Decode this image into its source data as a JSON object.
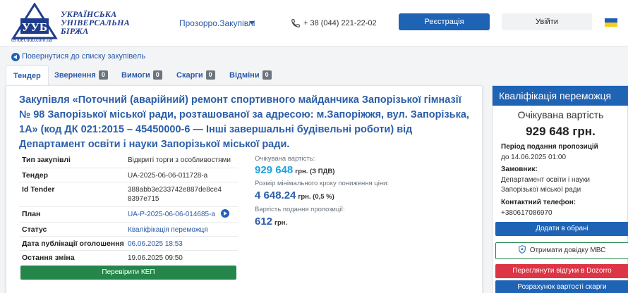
{
  "header": {
    "logo_lines": [
      "УКРАЇНСЬКА",
      "УНІВЕРСАЛЬНА",
      "БІРЖА"
    ],
    "logo_url": "tender.uub.com.ua",
    "nav_link": "Прозорро.Закупівлі",
    "phone": "+ 38 (044) 221-22-02",
    "register_label": "Реєстрація",
    "login_label": "Увійти"
  },
  "back_link": "Повернутися до списку закупівель",
  "tabs": [
    {
      "label": "Тендер",
      "active": true
    },
    {
      "label": "Звернення",
      "count": "0"
    },
    {
      "label": "Вимоги",
      "count": "0"
    },
    {
      "label": "Скарги",
      "count": "0"
    },
    {
      "label": "Відміни",
      "count": "0"
    }
  ],
  "tender": {
    "title": "Закупівля «Поточний (аварійний) ремонт спортивного майданчика Запорізької гімназії № 98 Запорізької міської ради, розташованої за адресою: м.Запоріжжя, вул. Запорізька, 1А» (код ДК 021:2015 – 45450000-6 — Інші завершальні будівельні роботи) від Департамент освіти і науки Запорізької міської ради.",
    "rows": [
      {
        "key": "Тип закупівлі",
        "value": "Відкриті торги з особливостями"
      },
      {
        "key": "Тендер",
        "value": "UA-2025-06-06-011728-a"
      },
      {
        "key": "Id Tender",
        "value": "388abb3e233742e887de8ce48397e715"
      },
      {
        "key": "План",
        "value": "UA-P-2025-06-06-014685-a"
      },
      {
        "key": "Статус",
        "value": "Кваліфікація переможця"
      },
      {
        "key": "Дата публікації оголошення",
        "value": "06.06.2025 18:53"
      },
      {
        "key": "Остання зміна",
        "value": "19.06.2025 09:50"
      }
    ],
    "check_kep_label": "Перевірити КЕП",
    "expected_label": "Очікувана вартість:",
    "expected_value": "929 648",
    "expected_unit": "грн. (З ПДВ)",
    "step_label": "Розмір мінімального кроку пониження ціни:",
    "step_value": "4 648.24",
    "step_unit": "грн. (0,5 %)",
    "cost_label": "Вартість подання пропозиції:",
    "cost_value": "612",
    "cost_unit": "грн."
  },
  "sidebar": {
    "heading": "Кваліфікація переможця",
    "expected_label": "Очікувана вартість",
    "expected_value": "929 648 грн.",
    "period_label": "Період подання пропозицій",
    "period_value": "до 14.06.2025 01:00",
    "customer_label": "Замовник:",
    "customer_value": "Департамент освіти і науки Запорізької міської ради",
    "contact_label": "Контактний телефон:",
    "contact_value": "+380617086970",
    "btn_favorites": "Додати в обрані",
    "btn_mvs": "Отримати довідку МВС",
    "btn_reviews": "Переглянути відгуки в Dozorro",
    "btn_calc": "Розрахунок вартості скарги"
  },
  "colors": {
    "primary": "#1f63b5",
    "link": "#2a5aa8",
    "success": "#24864a",
    "danger": "#dc3545",
    "value_highlight": "#1aa3e0",
    "value_dark": "#2b5ea8"
  }
}
